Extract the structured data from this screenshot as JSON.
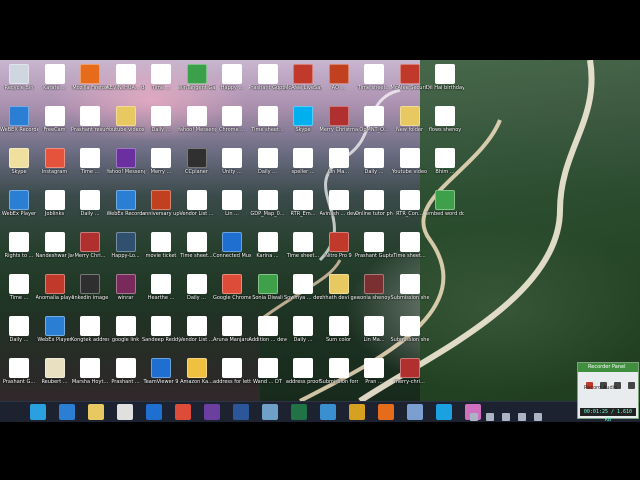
{
  "desktop": {
    "icons": [
      [
        "Recycle Bin",
        "#cfd6e0"
      ],
      [
        "WeBEX Recorder",
        "#2a7fd4"
      ],
      [
        "Skype",
        "#f0e0a0"
      ],
      [
        "WebEx Player",
        "#2a7fd4"
      ],
      [
        "Rights to ...",
        "#ffffff"
      ],
      [
        "Time ...",
        "#ffffff"
      ],
      [
        "Daily ...",
        "#ffffff"
      ],
      [
        "Prashant G...",
        "#ffffff"
      ],
      [
        "Karate ...",
        "#ffffff"
      ],
      [
        "FreeCam",
        "#ffffff"
      ],
      [
        "Instagram",
        "#e5533d"
      ],
      [
        "Joblinks",
        "#ffffff"
      ],
      [
        "Nandeshwar Java devel...",
        "#ffffff"
      ],
      [
        "Anomalia player",
        "#c0392b"
      ],
      [
        "WebEx Player",
        "#2a7fd4"
      ],
      [
        "Reubert ...",
        "#e8e0c0"
      ],
      [
        "Mozilla Firefox",
        "#e66b1a"
      ],
      [
        "Prashant resume...",
        "#ffffff"
      ],
      [
        "Time ...",
        "#ffffff"
      ],
      [
        "Daily ...",
        "#ffffff"
      ],
      [
        "Merry Chri...",
        "#b03030"
      ],
      [
        "linkedin image",
        "#2f2f2f"
      ],
      [
        "Kongtek address",
        "#ffffff"
      ],
      [
        "Marsha Hoyt...",
        "#ffffff"
      ],
      [
        "KEVIN_HUA... developer",
        "#ffffff"
      ],
      [
        "Youtube videos",
        "#e8c860"
      ],
      [
        "Yahoo! Messenger",
        "#6b2fa0"
      ],
      [
        "WebEx Recorder",
        "#2a7fd4"
      ],
      [
        "Happy-Lo...",
        "#305070"
      ],
      [
        "winrar",
        "#7a2a5a"
      ],
      [
        "google link",
        "#ffffff"
      ],
      [
        "Prashant ...",
        "#ffffff"
      ],
      [
        "Time ...",
        "#ffffff"
      ],
      [
        "Daily ...",
        "#ffffff"
      ],
      [
        "Merry ...",
        "#ffffff"
      ],
      [
        "anniversary uponder",
        "#c04020"
      ],
      [
        "movie ticket",
        "#ffffff"
      ],
      [
        "Hearthe ...",
        "#ffffff"
      ],
      [
        "Sandeep Reddy...",
        "#ffffff"
      ],
      [
        "TeamViewer 9",
        "#1e6fd0"
      ],
      [
        "WinTangent Games For...",
        "#3aa04a"
      ],
      [
        "Yahoo! Messenger",
        "#ffffff"
      ],
      [
        "CCplaner",
        "#303030"
      ],
      [
        "Vendor List ...",
        "#ffffff"
      ],
      [
        "Time sheet...",
        "#ffffff"
      ],
      [
        "Daily ...",
        "#ffffff"
      ],
      [
        "Vendor List ...",
        "#ffffff"
      ],
      [
        "Amazon Ka...",
        "#f0c040"
      ],
      [
        "Happy ...",
        "#ffffff"
      ],
      [
        "Chrome ...",
        "#ffffff"
      ],
      [
        "Unity ...",
        "#ffffff"
      ],
      [
        "Lin ...",
        "#ffffff"
      ],
      [
        "Connected Music pow...",
        "#1e6fd0"
      ],
      [
        "Google Chrome",
        "#dd4b39"
      ],
      [
        "Aruna Manjaru...",
        "#ffffff"
      ],
      [
        "address for letter",
        "#ffffff"
      ],
      [
        "Prashant Gupta...",
        "#ffffff"
      ],
      [
        "Time sheet...",
        "#ffffff"
      ],
      [
        "Daily ...",
        "#ffffff"
      ],
      [
        "GDP_Map_0...",
        "#ffffff"
      ],
      [
        "Karina ...",
        "#ffffff"
      ],
      [
        "Sonia Diwali",
        "#3fa04a"
      ],
      [
        "Addition ... developer",
        "#ffffff"
      ],
      [
        "Wand ... DT",
        "#ffffff"
      ],
      [
        "McAfee LiveSaf...",
        "#c0392b"
      ],
      [
        "Skype",
        "#00aff0"
      ],
      [
        "speller ...",
        "#ffffff"
      ],
      [
        "RTR_Em...",
        "#ffffff"
      ],
      [
        "Time sheet...",
        "#ffffff"
      ],
      [
        "Sowmya ... developer",
        "#ffffff"
      ],
      [
        "Daily ...",
        "#ffffff"
      ],
      [
        "address proof",
        "#ffffff"
      ],
      [
        "AO ...",
        "#c04020"
      ],
      [
        "Merry Christmas",
        "#b03030"
      ],
      [
        "Lin Ma...",
        "#ffffff"
      ],
      [
        "Avinash ... developer",
        "#ffffff"
      ],
      [
        "Nitro Pro 9",
        "#c0392b"
      ],
      [
        "chhath devi geet",
        "#e8c860"
      ],
      [
        "Sum color",
        "#ffffff"
      ],
      [
        "Submission format",
        "#ffffff"
      ],
      [
        "Time sheet...",
        "#ffffff"
      ],
      [
        "OpMNT_O...",
        "#ffffff"
      ],
      [
        "Daily ...",
        "#ffffff"
      ],
      [
        "Online tutor physics E...",
        "#ffffff"
      ],
      [
        "Prashant Gupta...",
        "#ffffff"
      ],
      [
        "sonia shenoy",
        "#7a3030"
      ],
      [
        "Lin Ma...",
        "#ffffff"
      ],
      [
        "Pran ...",
        "#ffffff"
      ],
      [
        "McAfee Security S...",
        "#c0392b"
      ],
      [
        "New folder",
        "#e8c860"
      ],
      [
        "Youtube video",
        "#ffffff"
      ],
      [
        "RTR_Con...",
        "#ffffff"
      ],
      [
        "Time sheet...",
        "#ffffff"
      ],
      [
        "Submission sheet...",
        "#ffffff"
      ],
      [
        "Submission sheet...",
        "#ffffff"
      ],
      [
        "merry-chri...",
        "#b03030"
      ],
      [
        "Dil Hai birthday...",
        "#ffffff"
      ],
      [
        "flows shenoy",
        "#ffffff"
      ],
      [
        "Bhim ...",
        "#ffffff"
      ],
      [
        "embed word document",
        "#3fa04a"
      ]
    ]
  },
  "taskbar": {
    "apps": [
      [
        "start-button",
        "#2aa0e0"
      ],
      [
        "ie-icon",
        "#2a7fd4"
      ],
      [
        "file-explorer-icon",
        "#e8c860"
      ],
      [
        "camera-icon",
        "#e0e0e0"
      ],
      [
        "hp-icon",
        "#1e6fd0"
      ],
      [
        "chrome-icon",
        "#dd4b39"
      ],
      [
        "media-icon",
        "#6b3fa0"
      ],
      [
        "word-icon",
        "#2b579a"
      ],
      [
        "notepad-icon",
        "#6fa0c8"
      ],
      [
        "excel-icon",
        "#217346"
      ],
      [
        "settings-icon",
        "#3a8fd0"
      ],
      [
        "outlook-icon",
        "#d6a020"
      ],
      [
        "firefox-icon",
        "#e66b1a"
      ],
      [
        "doc-icon",
        "#7a9fd0"
      ],
      [
        "chat-icon",
        "#1ba1e2"
      ],
      [
        "game-icon",
        "#d070c0"
      ]
    ]
  },
  "recorder": {
    "title": "Recorder Panel",
    "audio_label": "Record Audio",
    "status": "00:01:25 / 1.610 KB"
  }
}
